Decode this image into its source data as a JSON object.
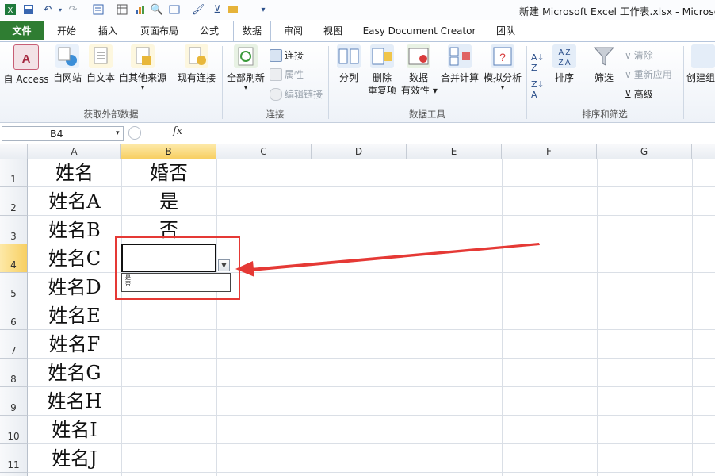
{
  "window": {
    "title": "新建 Microsoft Excel 工作表.xlsx - Microso"
  },
  "quick_access": {
    "icons": [
      "excel-logo-icon",
      "save-icon",
      "undo-icon",
      "redo-icon",
      "form-icon",
      "table-icon",
      "chart-icon",
      "print-preview-icon",
      "sort-icon",
      "brush-icon",
      "filter-icon",
      "sheet-icon",
      "customize-icon"
    ]
  },
  "tabs": [
    "文件",
    "开始",
    "插入",
    "页面布局",
    "公式",
    "数据",
    "审阅",
    "视图",
    "Easy Document Creator",
    "团队"
  ],
  "active_tab": "数据",
  "ribbon": {
    "external": {
      "access": "自 Access",
      "web": "自网站",
      "text": "自文本",
      "other": "自其他来源",
      "existing": "现有连接",
      "group_label": "获取外部数据"
    },
    "connections": {
      "refresh_all": "全部刷新",
      "connections": "连接",
      "properties": "属性",
      "edit_links": "编辑链接",
      "group_label": "连接"
    },
    "data_tools": {
      "text_to_columns": "分列",
      "remove_dup_1": "删除",
      "remove_dup_2": "重复项",
      "validation_1": "数据",
      "validation_2": "有效性",
      "consolidate": "合并计算",
      "what_if": "模拟分析",
      "group_label": "数据工具"
    },
    "sort_filter": {
      "sort": "排序",
      "filter": "筛选",
      "clear": "清除",
      "reapply": "重新应用",
      "advanced": "高级",
      "group_label": "排序和筛选"
    },
    "outline": {
      "group": "创建组"
    }
  },
  "formula_bar": {
    "name_box": "B4",
    "fx": "fx",
    "formula": ""
  },
  "columns": [
    "A",
    "B",
    "C",
    "D",
    "E",
    "F",
    "G"
  ],
  "rows": [
    "1",
    "2",
    "3",
    "4",
    "5",
    "6",
    "7",
    "8",
    "9",
    "10",
    "11"
  ],
  "cells": {
    "A": [
      "姓名",
      "姓名A",
      "姓名B",
      "姓名C",
      "姓名D",
      "姓名E",
      "姓名F",
      "姓名G",
      "姓名H",
      "姓名I",
      "姓名J"
    ],
    "B": [
      "婚否",
      "是",
      "否"
    ]
  },
  "dropdown": {
    "options": [
      "是",
      "否"
    ]
  },
  "colors": {
    "file_tab": "#2f7d32",
    "highlight": "#e53935",
    "selected_header": "#f7cf62"
  }
}
